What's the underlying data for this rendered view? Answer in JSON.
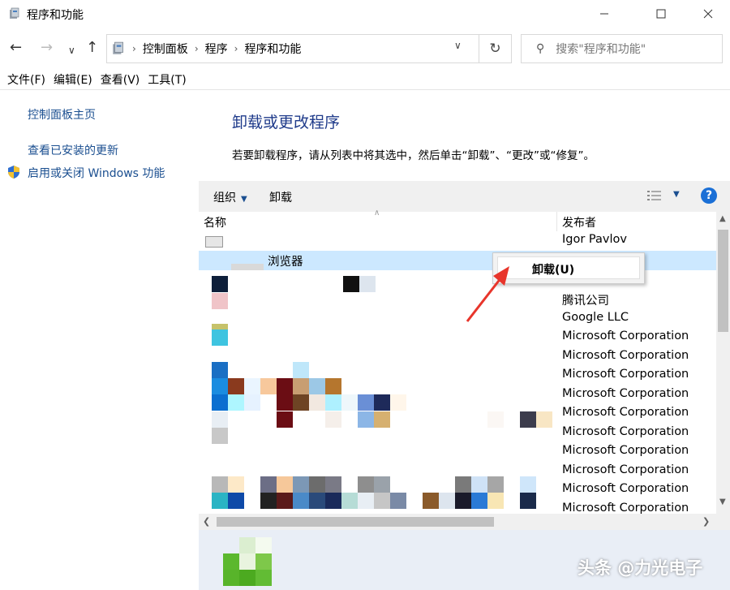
{
  "window": {
    "title": "程序和功能",
    "minimize_icon": "minimize-icon",
    "maximize_icon": "maximize-icon",
    "close_icon": "close-icon"
  },
  "address_bar": {
    "breadcrumbs": [
      "控制面板",
      "程序",
      "程序和功能"
    ],
    "search_placeholder": "搜索\"程序和功能\""
  },
  "menu": {
    "items": [
      "文件(F)",
      "编辑(E)",
      "查看(V)",
      "工具(T)"
    ]
  },
  "sidebar": {
    "links": [
      "控制面板主页",
      "查看已安装的更新",
      "启用或关闭 Windows 功能"
    ]
  },
  "main": {
    "title": "卸载或更改程序",
    "description": "若要卸载程序，请从列表中将其选中，然后单击“卸载”、“更改”或“修复”。"
  },
  "toolbar": {
    "organize_label": "组织",
    "uninstall_label": "卸载",
    "help_label": "?"
  },
  "list": {
    "columns": [
      "名称",
      "发布者"
    ],
    "rows": [
      {
        "name": "",
        "publisher": "Igor Pavlov"
      },
      {
        "name": "浏览器",
        "publisher": "",
        "selected": true
      },
      {
        "name": "",
        "publisher": ""
      },
      {
        "name": "",
        "publisher": "腾讯公司"
      },
      {
        "name": "",
        "publisher": "Google LLC"
      },
      {
        "name": "",
        "publisher": "Microsoft Corporation"
      },
      {
        "name": "",
        "publisher": "Microsoft Corporation"
      },
      {
        "name": "",
        "publisher": "Microsoft Corporation"
      },
      {
        "name": "",
        "publisher": "Microsoft Corporation"
      },
      {
        "name": "",
        "publisher": "Microsoft Corporation"
      },
      {
        "name": "",
        "publisher": "Microsoft Corporation"
      },
      {
        "name": "",
        "publisher": "Microsoft Corporation"
      },
      {
        "name": "",
        "publisher": "Microsoft Corporation"
      },
      {
        "name": "",
        "publisher": "Microsoft Corporation"
      },
      {
        "name": "",
        "publisher": "Microsoft Corporation"
      }
    ]
  },
  "context_menu": {
    "items": [
      "卸载(U)"
    ]
  },
  "watermark": "头条 @力光电子",
  "colors": {
    "link": "#1b4f90",
    "title_blue": "#1e3a8a",
    "selection": "#cce8ff",
    "annotation_red": "#e8352b",
    "help_blue": "#1a6fd6"
  }
}
